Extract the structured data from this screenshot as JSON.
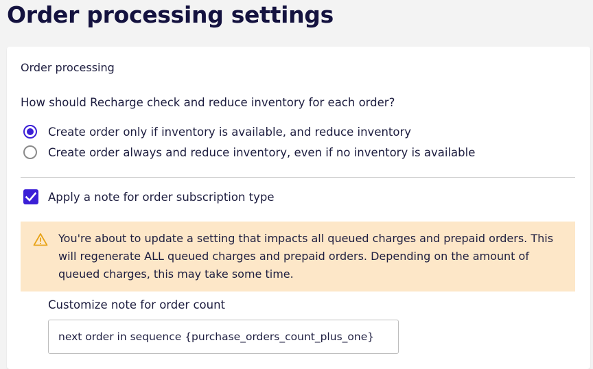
{
  "page": {
    "title": "Order processing settings"
  },
  "order_processing": {
    "section_title": "Order processing",
    "question": "How should Recharge check and reduce inventory for each order?",
    "options": [
      {
        "label": "Create order only if inventory is available, and reduce inventory",
        "selected": true
      },
      {
        "label": "Create order always and reduce inventory, even if no inventory is available",
        "selected": false
      }
    ],
    "note_checkbox": {
      "label": "Apply a note for order subscription type",
      "checked": true
    },
    "warning": {
      "icon": "warning-triangle-icon",
      "text": "You're about to update a setting that impacts all queued charges and prepaid orders. This will regenerate ALL queued charges and prepaid orders. Depending on the amount of queued charges, this may take some time."
    },
    "note_field": {
      "label": "Customize note for order count",
      "value": "next order in sequence {purchase_orders_count_plus_one}"
    }
  },
  "colors": {
    "accent": "#3b1fd6",
    "warning_bg": "#fde7c8",
    "warning_icon": "#e8a317",
    "title": "#14123f"
  }
}
